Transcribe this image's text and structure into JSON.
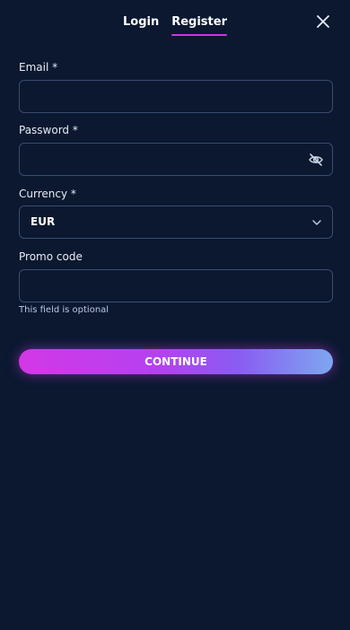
{
  "tabs": [
    {
      "label": "Login",
      "active": false
    },
    {
      "label": "Register",
      "active": true
    }
  ],
  "close_icon": "close-icon",
  "form": {
    "email": {
      "label": "Email *",
      "value": "",
      "placeholder": ""
    },
    "password": {
      "label": "Password *",
      "value": "",
      "placeholder": "",
      "toggle_icon": "eye-off-icon"
    },
    "currency": {
      "label": "Currency *",
      "value": "EUR",
      "chevron_icon": "chevron-down-icon"
    },
    "promo": {
      "label": "Promo code",
      "value": "",
      "placeholder": "",
      "helper": "This field is optional"
    }
  },
  "continue_label": "CONTINUE",
  "colors": {
    "background": "#0b1830",
    "field_border": "#3a4c6e",
    "tab_underline": "#c63ae0",
    "button_gradient_start": "#d338e6",
    "button_gradient_end": "#7da7ef"
  }
}
